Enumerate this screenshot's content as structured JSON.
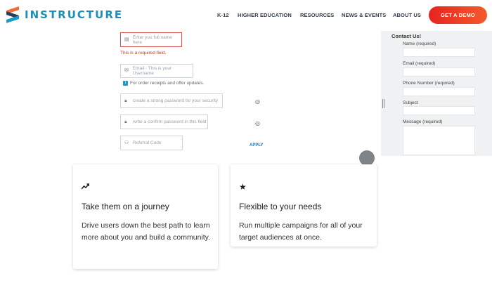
{
  "header": {
    "logo_text": "INSTRUCTURE",
    "nav": [
      "K-12",
      "HIGHER EDUCATION",
      "RESOURCES",
      "NEWS & EVENTS",
      "ABOUT US"
    ],
    "cta_label": "GET A DEMO"
  },
  "form": {
    "name_placeholder": "Enter you full name here",
    "name_error": "This is a required field.",
    "email_placeholder": "Email - This is your Username",
    "email_hint": "For order receipts and offer updates.",
    "password_placeholder": "create a strong password for your security",
    "confirm_placeholder": "write a confirm password in this field",
    "referral_placeholder": "Referral Code",
    "apply_label": "APPLY"
  },
  "contact": {
    "title": "Contact Us!",
    "fields": [
      "Name (required)",
      "Email (required)",
      "Phone Number (required)",
      "Subject",
      "Message (required)"
    ]
  },
  "cards": [
    {
      "icon": "trending-up-icon",
      "title": "Take them on a journey",
      "body": "Drive users down the best path to learn more about you and build a community."
    },
    {
      "icon": "star-icon",
      "title": "Flexible to your needs",
      "body": "Run multiple campaigns for all of your target audiences at once."
    }
  ],
  "colors": {
    "brand": "#1b8fb8",
    "navy": "#2b3f5c",
    "cta_start": "#e8231f",
    "cta_end": "#f45a2c",
    "error": "#d9534f"
  }
}
